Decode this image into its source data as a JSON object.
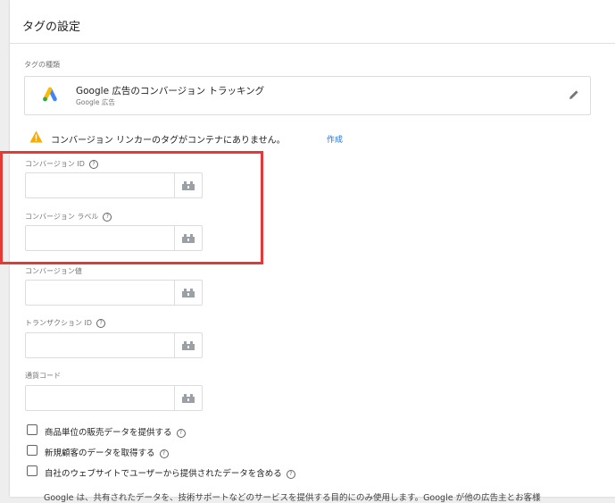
{
  "panel": {
    "title": "タグの設定"
  },
  "tag_type": {
    "section_label": "タグの種類",
    "title": "Google 広告のコンバージョン トラッキング",
    "subtitle": "Google 広告",
    "logo_icon": "google-ads-logo",
    "edit_icon": "pencil-icon"
  },
  "warning": {
    "icon": "warning-triangle-icon",
    "text": "コンバージョン リンカーのタグがコンテナにありません。",
    "link": "作成"
  },
  "fields": [
    {
      "label": "コンバージョン ID",
      "help": "?",
      "value": ""
    },
    {
      "label": "コンバージョン ラベル",
      "help": "?",
      "value": ""
    },
    {
      "label": "コンバージョン値",
      "help": "",
      "value": ""
    },
    {
      "label": "トランザクション ID",
      "help": "?",
      "value": ""
    },
    {
      "label": "通貨コード",
      "help": "",
      "value": ""
    }
  ],
  "checkboxes": [
    {
      "label": "商品単位の販売データを提供する",
      "checked": false
    },
    {
      "label": "新規顧客のデータを取得する",
      "checked": false
    },
    {
      "label": "自社のウェブサイトでユーザーから提供されたデータを含める",
      "checked": false
    }
  ],
  "footer": {
    "text": "Google は、共有されたデータを、技術サポートなどのサービスを提供する目的にのみ使用します。Google が他の広告主とお客様"
  },
  "colors": {
    "accent_link": "#1a73e8",
    "warning": "#f9ab00",
    "highlight_border": "#e53935"
  }
}
